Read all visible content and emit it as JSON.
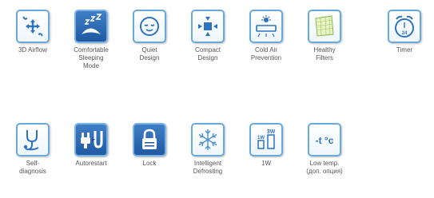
{
  "features_row1": [
    {
      "label": "3D Airflow",
      "icon": "arrows-3d-icon"
    },
    {
      "label": "Comfortable\nSleeping\nMode",
      "icon": "sleep-icon"
    },
    {
      "label": "Quiet\nDesign",
      "icon": "quiet-face-icon"
    },
    {
      "label": "Compact\nDesign",
      "icon": "compact-icon"
    },
    {
      "label": "Cold Air\nPrevention",
      "icon": "cold-air-icon"
    },
    {
      "label": "Healthy\nFilters",
      "icon": "filter-icon"
    },
    {
      "label": "Timer",
      "icon": "timer-icon",
      "timer_text": "24"
    }
  ],
  "features_row2": [
    {
      "label": "Self-\ndiagnosis",
      "icon": "stethoscope-icon"
    },
    {
      "label": "Autorestart",
      "icon": "plug-icon"
    },
    {
      "label": "Lock",
      "icon": "lock-icon"
    },
    {
      "label": "Intelligent\nDefrosting",
      "icon": "snowflake-icon"
    },
    {
      "label": "1W",
      "icon": "power-1w-icon",
      "small_text": "1W",
      "big_text": "3W"
    },
    {
      "label": "Low temp.\n(доп. опция)",
      "icon": "low-temp-icon",
      "temp_text": "-t °c"
    }
  ],
  "colors": {
    "accent": "#2e73bd",
    "border": "#6aa9dc",
    "text": "#555555"
  }
}
